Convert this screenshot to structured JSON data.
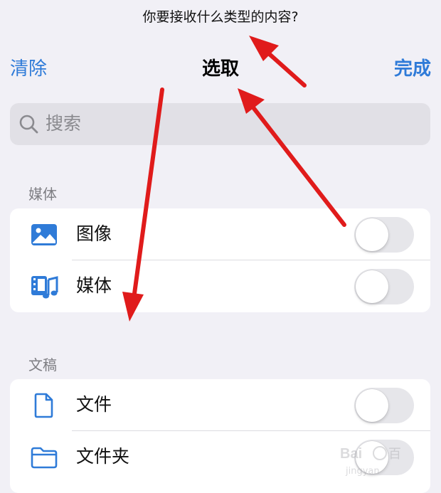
{
  "prompt": "你要接收什么类型的内容?",
  "nav": {
    "clear": "清除",
    "title": "选取",
    "done": "完成"
  },
  "search": {
    "placeholder": "搜索"
  },
  "sections": [
    {
      "header": "媒体",
      "items": [
        {
          "label": "图像",
          "icon": "photo-icon",
          "on": false
        },
        {
          "label": "媒体",
          "icon": "media-icon",
          "on": false
        }
      ]
    },
    {
      "header": "文稿",
      "items": [
        {
          "label": "文件",
          "icon": "document-icon",
          "on": false
        },
        {
          "label": "文件夹",
          "icon": "folder-icon",
          "on": false
        }
      ]
    }
  ],
  "colors": {
    "accent": "#2f7bd8",
    "background": "#f1f0f6",
    "annotation_arrow": "#e01b1b"
  },
  "watermark": "Baidu 经验"
}
